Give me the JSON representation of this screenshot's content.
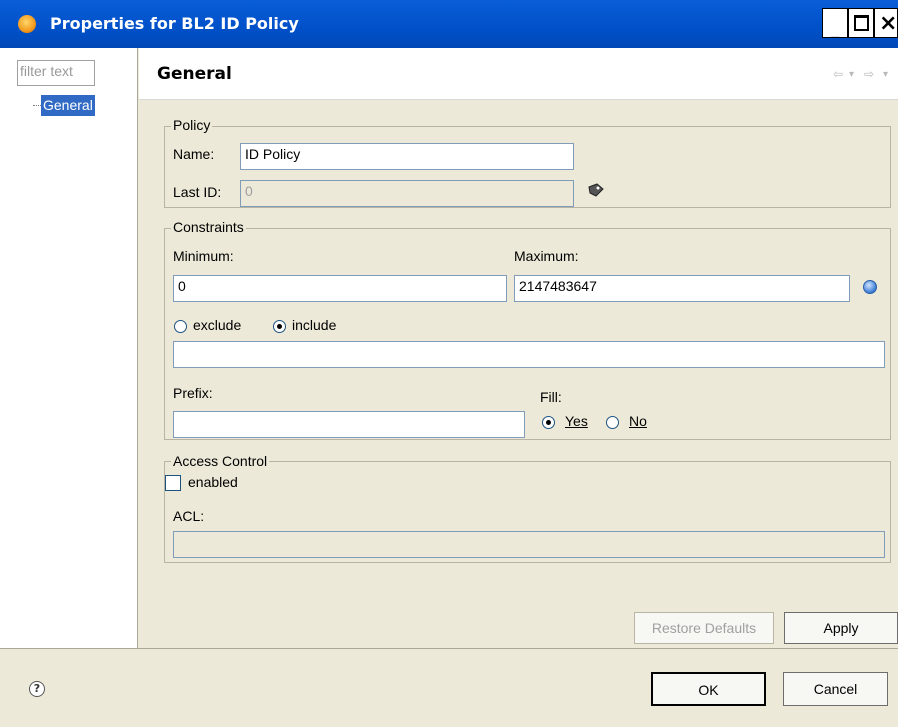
{
  "window": {
    "title": "Properties for BL2 ID Policy",
    "minimize_label": "_",
    "maximize_label": "□",
    "close_label": "×"
  },
  "sidebar": {
    "filter_placeholder": "filter text",
    "tree": [
      {
        "label": "General",
        "selected": true
      }
    ]
  },
  "page": {
    "title": "General",
    "nav_back": "⇦",
    "nav_dropdown": "▾",
    "nav_forward": "⇨"
  },
  "policy": {
    "legend": "Policy",
    "name_label": "Name:",
    "name_value": "ID Policy",
    "last_id_label": "Last ID:",
    "last_id_value": "0"
  },
  "constraints": {
    "legend": "Constraints",
    "minimum_label": "Minimum:",
    "minimum_value": "0",
    "maximum_label": "Maximum:",
    "maximum_value": "2147483647",
    "exclude_label": "exclude",
    "include_label": "include",
    "selected_mode": "include",
    "pattern_value": "",
    "prefix_label": "Prefix:",
    "prefix_value": "",
    "fill_label": "Fill:",
    "fill_yes": "Yes",
    "fill_no": "No",
    "fill_selected": "Yes"
  },
  "access_control": {
    "legend": "Access Control",
    "enabled_label": "enabled",
    "enabled": false,
    "acl_label": "ACL:",
    "acl_value": ""
  },
  "buttons": {
    "restore_defaults": "Restore Defaults",
    "apply": "Apply",
    "ok": "OK",
    "cancel": "Cancel"
  },
  "icons": {
    "app": "properties-app-icon",
    "last_id_action": "tag-icon",
    "info": "info-icon",
    "help": "help-icon"
  },
  "colors": {
    "titlebar": "#0054e3",
    "selection": "#316ac5",
    "dialog_bg": "#ece9d8"
  }
}
